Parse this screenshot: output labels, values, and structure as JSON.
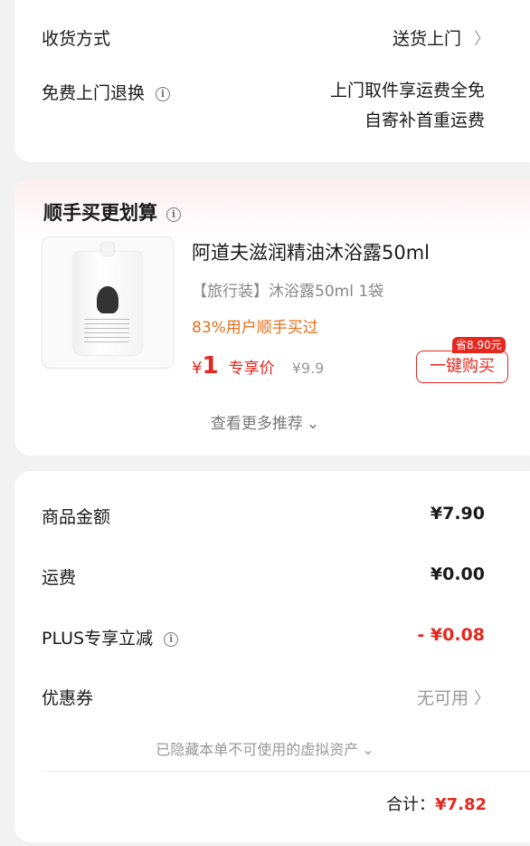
{
  "delivery": {
    "method_label": "收货方式",
    "method_value": "送货上门",
    "return_label": "免费上门退换",
    "return_value_line1": "上门取件享运费全免",
    "return_value_line2": "自寄补首重运费"
  },
  "addon": {
    "title": "顺手买更划算",
    "product": {
      "name": "阿道夫滋润精油沐浴露50ml",
      "spec": "【旅行装】沐浴露50ml 1袋",
      "social_proof": "83%用户顺手买过",
      "currency": "¥",
      "price": "1",
      "price_tag": "专享价",
      "original_price": "¥9.9",
      "save_badge": "省8.90元",
      "buy_label": "一键购买"
    },
    "more_label": "查看更多推荐"
  },
  "summary": {
    "rows": [
      {
        "label": "商品金额",
        "value": "¥7.90"
      },
      {
        "label": "运费",
        "value": "¥0.00"
      },
      {
        "label": "PLUS专享立减",
        "value": "- ¥0.08"
      },
      {
        "label": "优惠券",
        "value": "无可用"
      }
    ],
    "hidden_assets": "已隐藏本单不可使用的虚拟资产",
    "total_label": "合计：",
    "total_value": "¥7.82"
  },
  "icons": [
    "info-icon",
    "chevron-right-icon",
    "chevron-down-icon"
  ],
  "colors": {
    "accent": "#e4281f",
    "social": "#e3701c",
    "muted": "#999999",
    "background": "#f2f2f2"
  }
}
